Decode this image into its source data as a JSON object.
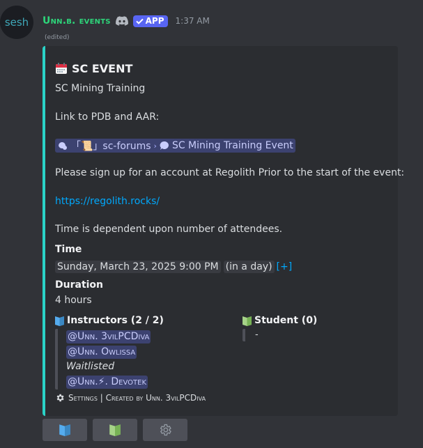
{
  "avatar": {
    "text": "sesh"
  },
  "header": {
    "username": "Unn.b. events",
    "app_tag": "APP",
    "timestamp": "1:37 AM",
    "edited": "(edited)"
  },
  "embed": {
    "accent_color": "#2ad3c7",
    "title": "SC EVENT",
    "description_line1": "SC Mining Training",
    "description_line2": "Link to PDB and AAR:",
    "channel_chip": {
      "forum_name": "「📜」sc-forums",
      "separator": "›",
      "thread_name": "SC Mining Training Event"
    },
    "description_line3": "Please sign up for an account at Regolith Prior to the start of the event:",
    "link": "https://regolith.rocks/",
    "description_line4": "Time is dependent upon number of attendees.",
    "time_label": "Time",
    "time_value": "Sunday, March 23, 2025 9:00 PM",
    "time_relative": "(in a day)",
    "time_add": "[+]",
    "duration_label": "Duration",
    "duration_value": "4 hours",
    "instructors": {
      "title": "Instructors (2 / 2)",
      "icon": "blue-book-icon",
      "members": [
        "@Unn. 3vilPCDiva",
        "@Unn. Owlissa"
      ],
      "waitlist_label": "Waitlisted",
      "waitlist": [
        "@Unn.⚡. Devotek"
      ]
    },
    "students": {
      "title": "Student (0)",
      "icon": "green-book-icon",
      "empty": "-"
    },
    "footer": "Settings | Created by Unn. 3vilPCDiva"
  },
  "buttons": [
    {
      "icon": "blue-book-icon"
    },
    {
      "icon": "green-book-icon"
    },
    {
      "icon": "gear-icon"
    }
  ]
}
